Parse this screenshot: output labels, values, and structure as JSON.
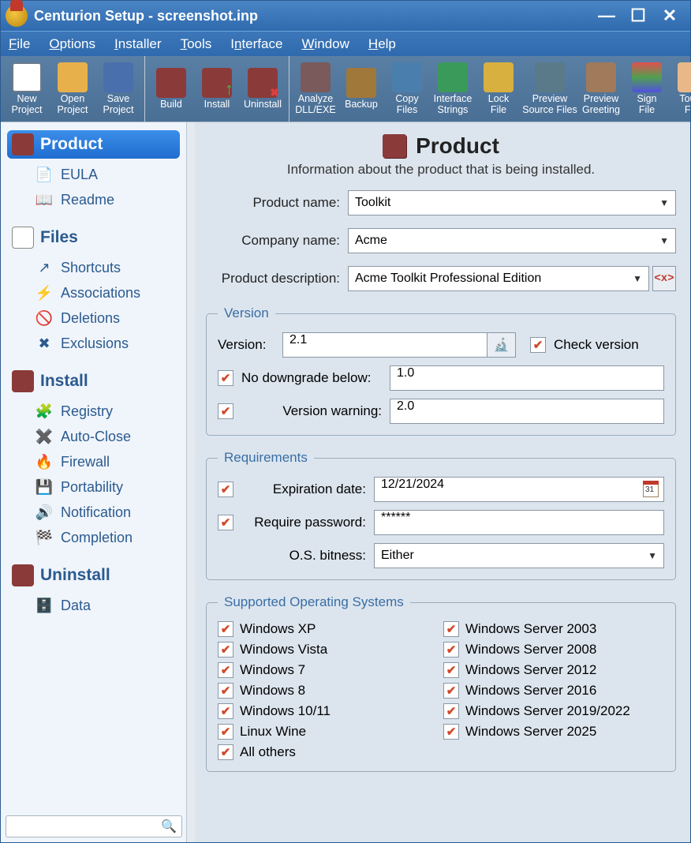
{
  "window": {
    "title": "Centurion Setup - screenshot.inp"
  },
  "menu": {
    "file": "File",
    "options": "Options",
    "installer": "Installer",
    "tools": "Tools",
    "interface": "Interface",
    "window_m": "Window",
    "help": "Help"
  },
  "toolbar": {
    "new": "New\nProject",
    "open": "Open\nProject",
    "save": "Save\nProject",
    "build": "Build",
    "install": "Install",
    "uninstall": "Uninstall",
    "analyze": "Analyze\nDLL/EXE",
    "backup": "Backup",
    "copy": "Copy\nFiles",
    "iface": "Interface\nStrings",
    "lock": "Lock\nFile",
    "prevsrc": "Preview\nSource Files",
    "prevgreet": "Preview\nGreeting",
    "sign": "Sign\nFile",
    "touch": "Touch\nFile"
  },
  "sidebar": {
    "product": "Product",
    "eula": "EULA",
    "readme": "Readme",
    "files": "Files",
    "shortcuts": "Shortcuts",
    "assoc": "Associations",
    "del": "Deletions",
    "excl": "Exclusions",
    "install": "Install",
    "registry": "Registry",
    "autoclose": "Auto-Close",
    "firewall": "Firewall",
    "portability": "Portability",
    "notification": "Notification",
    "completion": "Completion",
    "uninstall": "Uninstall",
    "data": "Data"
  },
  "page": {
    "heading": "Product",
    "sub": "Information about the product that is being installed.",
    "product_name_lbl": "Product name:",
    "product_name": "Toolkit",
    "company_lbl": "Company name:",
    "company": "Acme",
    "desc_lbl": "Product description:",
    "desc": "Acme Toolkit Professional Edition",
    "version_legend": "Version",
    "version_lbl": "Version:",
    "version": "2.1",
    "check_version": "Check version",
    "no_downgrade_lbl": "No downgrade below:",
    "no_downgrade": "1.0",
    "version_warn_lbl": "Version warning:",
    "version_warn": "2.0",
    "req_legend": "Requirements",
    "exp_lbl": "Expiration date:",
    "exp": "12/21/2024",
    "pw_lbl": "Require password:",
    "pw": "******",
    "bitness_lbl": "O.S. bitness:",
    "bitness": "Either",
    "os_legend": "Supported Operating Systems",
    "os": {
      "xp": "Windows XP",
      "s2003": "Windows Server 2003",
      "vista": "Windows Vista",
      "s2008": "Windows Server 2008",
      "w7": "Windows 7",
      "s2012": "Windows Server 2012",
      "w8": "Windows 8",
      "s2016": "Windows Server 2016",
      "w1011": "Windows 10/11",
      "s2019": "Windows Server 2019/2022",
      "wine": "Linux Wine",
      "s2025": "Windows Server 2025",
      "other": "All others"
    }
  }
}
